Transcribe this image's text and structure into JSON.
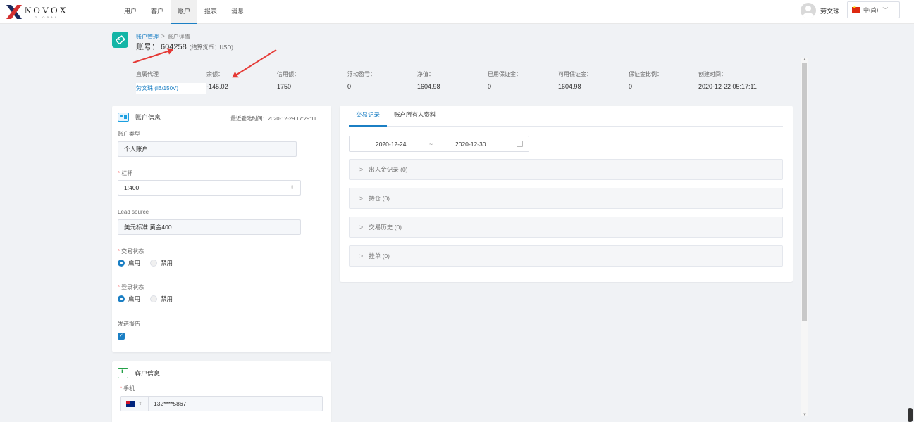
{
  "nav": {
    "logo_main": "NOVOX",
    "logo_sub": "GLOBAL",
    "menu": [
      "用户",
      "客户",
      "账户",
      "报表",
      "消息"
    ],
    "active_menu": "账户",
    "user_name": "劳文珠",
    "language": "中(简)"
  },
  "header": {
    "breadcrumb": [
      "账户管理",
      ">",
      "账户详情"
    ],
    "account_label": "账号：",
    "account_number": "604258",
    "currency_note": "(结算货币：USD)"
  },
  "stats": [
    {
      "label": "直属代理",
      "value": "劳文珠 (IB/150V)"
    },
    {
      "label": "余额：",
      "value": "-145.02"
    },
    {
      "label": "信用额：",
      "value": "1750"
    },
    {
      "label": "浮动盈亏：",
      "value": "0"
    },
    {
      "label": "净值：",
      "value": "1604.98"
    },
    {
      "label": "已用保证金：",
      "value": "0"
    },
    {
      "label": "可用保证金：",
      "value": "1604.98"
    },
    {
      "label": "保证金比例：",
      "value": "0"
    },
    {
      "label": "创建时间：",
      "value": "2020-12-22 05:17:11"
    }
  ],
  "account_info": {
    "title": "账户信息",
    "last_login": "最近登陆时间：2020-12-29 17:29:11",
    "account_type_label": "账户类型",
    "account_type_value": "个人账户",
    "leverage_label": "杠杆",
    "leverage_value": "1:400",
    "lead_source_label": "Lead source",
    "lead_source_value": "美元标准 黄金400",
    "trade_status_label": "交易状态",
    "login_status_label": "登录状态",
    "enable_label": "启用",
    "disable_label": "禁用",
    "send_report_label": "发送报告",
    "send_report_checked": true
  },
  "client_info": {
    "title": "客户信息",
    "phone_label": "手机",
    "phone_value": "132****5867"
  },
  "right_panel": {
    "tabs": [
      "交易记录",
      "账户所有人资料"
    ],
    "active_tab": "交易记录",
    "date_start": "2020-12-24",
    "date_sep": "~",
    "date_end": "2020-12-30",
    "sections": [
      "出入金记录 (0)",
      "持仓 (0)",
      "交易历史 (0)",
      "挂单 (0)"
    ]
  },
  "colors": {
    "accent": "#1b7fc4",
    "teal_icon": "#13b5a6",
    "annotation_arrow": "#e53935"
  }
}
